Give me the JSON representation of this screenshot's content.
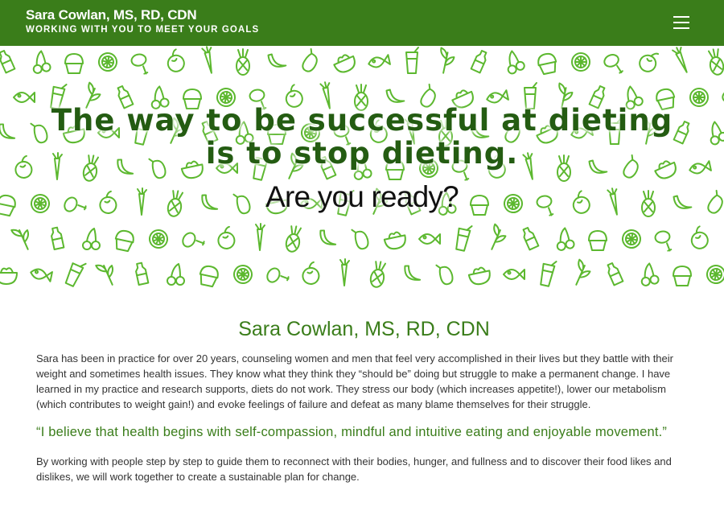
{
  "header": {
    "brand_name": "Sara Cowlan, MS, RD, CDN",
    "tagline": "WORKING WITH YOU TO MEET YOUR GOALS",
    "menu_icon": "hamburger-menu-icon"
  },
  "hero": {
    "headline": "The way to be successful at dieting is to stop dieting.",
    "subheadline": "Are you ready?",
    "pattern_color": "#5cb82f"
  },
  "about": {
    "title": "Sara Cowlan, MS, RD, CDN",
    "bio": "Sara has been in practice for over 20 years, counseling women and men that feel very accomplished in their lives but they battle with their weight and sometimes health issues. They know what they think they “should be” doing but struggle to make a permanent change. I have learned in my practice and research supports, diets do not work. They stress our body (which increases appetite!), lower our metabolism (which contributes to weight gain!) and evoke feelings of failure and defeat as many blame themselves for their struggle.",
    "quote": "“I believe that health begins with self-compassion, mindful and intuitive eating and enjoyable movement.”",
    "closing": "By working with people step by step to guide them to reconnect with their bodies, hunger, and fullness and to discover their food likes and dislikes, we will work together to create a sustainable plan for change."
  },
  "colors": {
    "header_bg": "#3a7d1a",
    "accent_green": "#3a7d1a",
    "headline_green": "#245c12",
    "body_text": "#333333"
  }
}
